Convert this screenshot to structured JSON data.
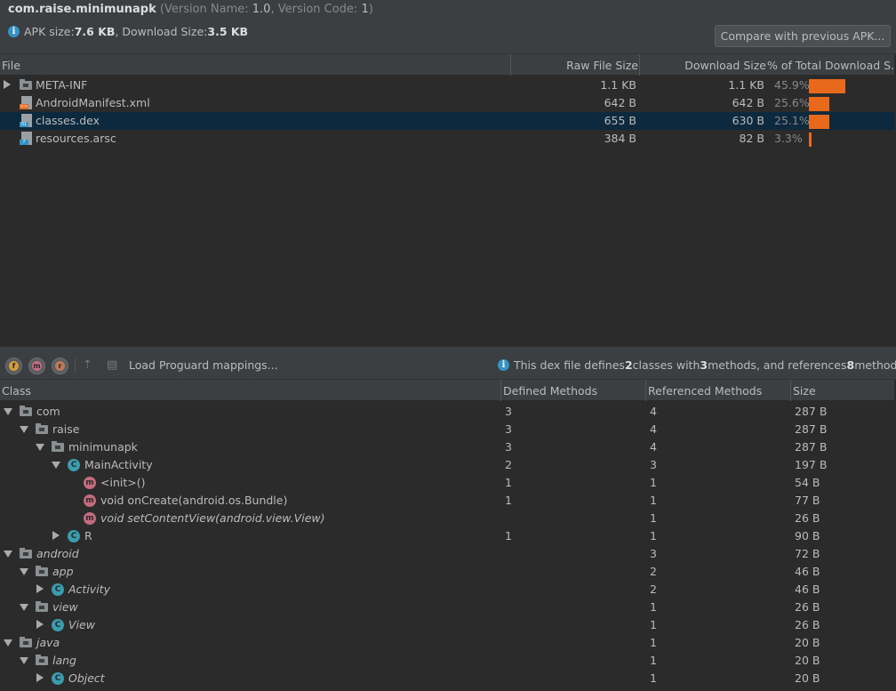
{
  "header": {
    "package": "com.raise.minimunapk",
    "version_prefix": "(Version Name: ",
    "version_name": "1.0",
    "version_mid": ", Version Code: ",
    "version_code": "1",
    "version_suffix": ")",
    "apk_size_label": "APK size: ",
    "apk_size": "7.6 KB",
    "download_size_label": ", Download Size: ",
    "download_size": "3.5 KB",
    "compare_button": "Compare with previous APK..."
  },
  "file_table": {
    "columns": [
      "File",
      "Raw File Size",
      "Download Size",
      "% of Total Download S..."
    ],
    "rows": [
      {
        "name": "META-INF",
        "raw": "1.1 KB",
        "download": "1.1 KB",
        "percent": "45.9%",
        "pct_value": 45.9,
        "type": "folder",
        "selected": false
      },
      {
        "name": "AndroidManifest.xml",
        "raw": "642 B",
        "download": "642 B",
        "percent": "25.6%",
        "pct_value": 25.6,
        "type": "xml",
        "selected": false
      },
      {
        "name": "classes.dex",
        "raw": "655 B",
        "download": "630 B",
        "percent": "25.1%",
        "pct_value": 25.1,
        "type": "dex",
        "selected": true
      },
      {
        "name": "resources.arsc",
        "raw": "384 B",
        "download": "82 B",
        "percent": "3.3%",
        "pct_value": 3.3,
        "type": "arsc",
        "selected": false
      }
    ]
  },
  "toolbar": {
    "load_proguard": "Load Proguard mappings...",
    "dex_info_prefix": "This dex file defines ",
    "classes_count": "2",
    "dex_info_mid1": " classes with ",
    "methods_count": "3",
    "dex_info_mid2": " methods, and references ",
    "references_count": "8",
    "dex_info_suffix": " methods."
  },
  "class_table": {
    "columns": [
      "Class",
      "Defined Methods",
      "Referenced Methods",
      "Size"
    ],
    "rows": [
      {
        "name": "com",
        "defined": "3",
        "referenced": "4",
        "size": "287 B"
      },
      {
        "name": "raise",
        "defined": "3",
        "referenced": "4",
        "size": "287 B"
      },
      {
        "name": "minimunapk",
        "defined": "3",
        "referenced": "4",
        "size": "287 B"
      },
      {
        "name": "MainActivity",
        "defined": "2",
        "referenced": "3",
        "size": "197 B"
      },
      {
        "name": "<init>()",
        "defined": "1",
        "referenced": "1",
        "size": "54 B"
      },
      {
        "name": "void onCreate(android.os.Bundle)",
        "defined": "1",
        "referenced": "1",
        "size": "77 B"
      },
      {
        "name": "void setContentView(android.view.View)",
        "defined": "",
        "referenced": "1",
        "size": "26 B"
      },
      {
        "name": "R",
        "defined": "1",
        "referenced": "1",
        "size": "90 B"
      },
      {
        "name": "android",
        "defined": "",
        "referenced": "3",
        "size": "72 B"
      },
      {
        "name": "app",
        "defined": "",
        "referenced": "2",
        "size": "46 B"
      },
      {
        "name": "Activity",
        "defined": "",
        "referenced": "2",
        "size": "46 B"
      },
      {
        "name": "view",
        "defined": "",
        "referenced": "1",
        "size": "26 B"
      },
      {
        "name": "View",
        "defined": "",
        "referenced": "1",
        "size": "26 B"
      },
      {
        "name": "java",
        "defined": "",
        "referenced": "1",
        "size": "20 B"
      },
      {
        "name": "lang",
        "defined": "",
        "referenced": "1",
        "size": "20 B"
      },
      {
        "name": "Object",
        "defined": "",
        "referenced": "1",
        "size": "20 B"
      }
    ]
  }
}
